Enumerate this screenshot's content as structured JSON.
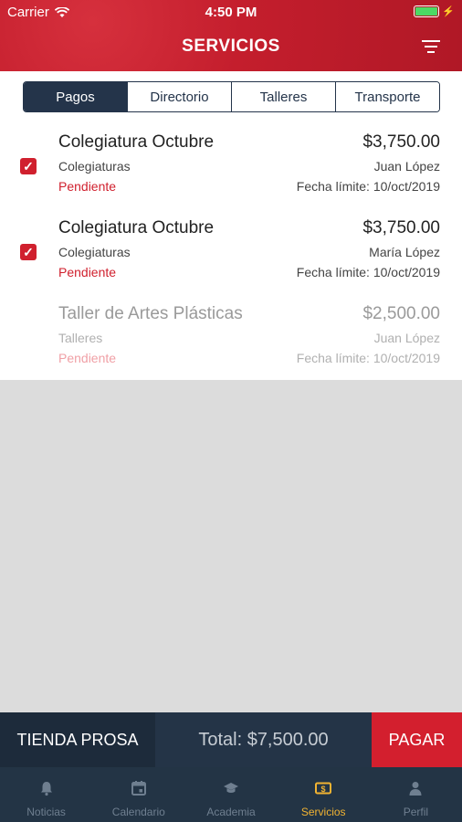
{
  "status_bar": {
    "carrier": "Carrier",
    "time": "4:50 PM"
  },
  "header": {
    "title": "SERVICIOS"
  },
  "segments": [
    {
      "label": "Pagos",
      "active": true
    },
    {
      "label": "Directorio",
      "active": false
    },
    {
      "label": "Talleres",
      "active": false
    },
    {
      "label": "Transporte",
      "active": false
    }
  ],
  "payments": [
    {
      "name": "Colegiatura Octubre",
      "amount": "$3,750.00",
      "category": "Colegiaturas",
      "person": "Juan López",
      "status": "Pendiente",
      "deadline": "Fecha límite: 10/oct/2019",
      "checked": true,
      "enabled": true
    },
    {
      "name": "Colegiatura Octubre",
      "amount": "$3,750.00",
      "category": "Colegiaturas",
      "person": "María López",
      "status": "Pendiente",
      "deadline": "Fecha límite: 10/oct/2019",
      "checked": true,
      "enabled": true
    },
    {
      "name": "Taller de Artes Plásticas",
      "amount": "$2,500.00",
      "category": "Talleres",
      "person": "Juan López",
      "status": "Pendiente",
      "deadline": "Fecha límite: 10/oct/2019",
      "checked": false,
      "enabled": false
    }
  ],
  "footer": {
    "store_label": "TIENDA PROSA",
    "total": "Total: $7,500.00",
    "pay_label": "PAGAR"
  },
  "tabs": [
    {
      "label": "Noticias",
      "icon": "bell-icon",
      "active": false
    },
    {
      "label": "Calendario",
      "icon": "calendar-icon",
      "active": false
    },
    {
      "label": "Academia",
      "icon": "graduation-cap-icon",
      "active": false
    },
    {
      "label": "Servicios",
      "icon": "money-icon",
      "active": true
    },
    {
      "label": "Perfil",
      "icon": "user-icon",
      "active": false
    }
  ],
  "colors": {
    "brand_red": "#d0202e",
    "navy": "#24344a",
    "active_tab": "#f1b332"
  }
}
